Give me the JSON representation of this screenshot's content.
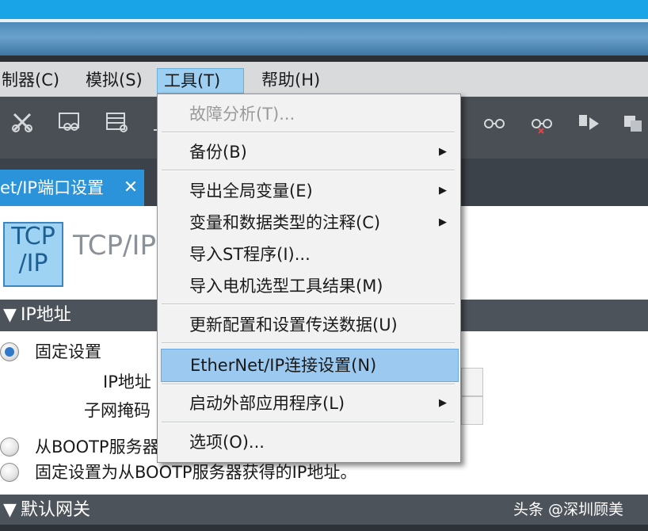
{
  "menubar": {
    "items": [
      {
        "label": "制器(C)"
      },
      {
        "label": "模拟(S)"
      },
      {
        "label": "工具(T)"
      },
      {
        "label": "帮助(H)"
      }
    ]
  },
  "tab": {
    "label": "et/IP端口设置",
    "close": "✕"
  },
  "panel": {
    "icon_line1": "TCP",
    "icon_line2": "/IP",
    "title": "TCP/IP"
  },
  "sections": {
    "ip_address": "IP地址",
    "default_gateway": "默认网关"
  },
  "ip_settings": {
    "fixed": "固定设置",
    "ip_label": "IP地址",
    "subnet_label": "子网掩码",
    "bootp": "从BOOTP服务器",
    "fixed_bootp": "固定设置为从BOOTP服务器获得的IP地址。"
  },
  "dropdown": {
    "items": [
      {
        "label": "故障分析(T)...",
        "disabled": true
      },
      {
        "label": "备份(B)",
        "submenu": true
      },
      {
        "label": "导出全局变量(E)",
        "submenu": true
      },
      {
        "label": "变量和数据类型的注释(C)",
        "submenu": true
      },
      {
        "label": "导入ST程序(I)..."
      },
      {
        "label": "导入电机选型工具结果(M)"
      },
      {
        "label": "更新配置和设置传送数据(U)"
      },
      {
        "label": "EtherNet/IP连接设置(N)",
        "highlighted": true
      },
      {
        "label": "启动外部应用程序(L)",
        "submenu": true
      },
      {
        "label": "选项(O)..."
      }
    ],
    "submenu_arrow": "▶"
  },
  "watermark": "头条 @深圳顾美",
  "icons": {
    "section_arrow": "▼"
  }
}
